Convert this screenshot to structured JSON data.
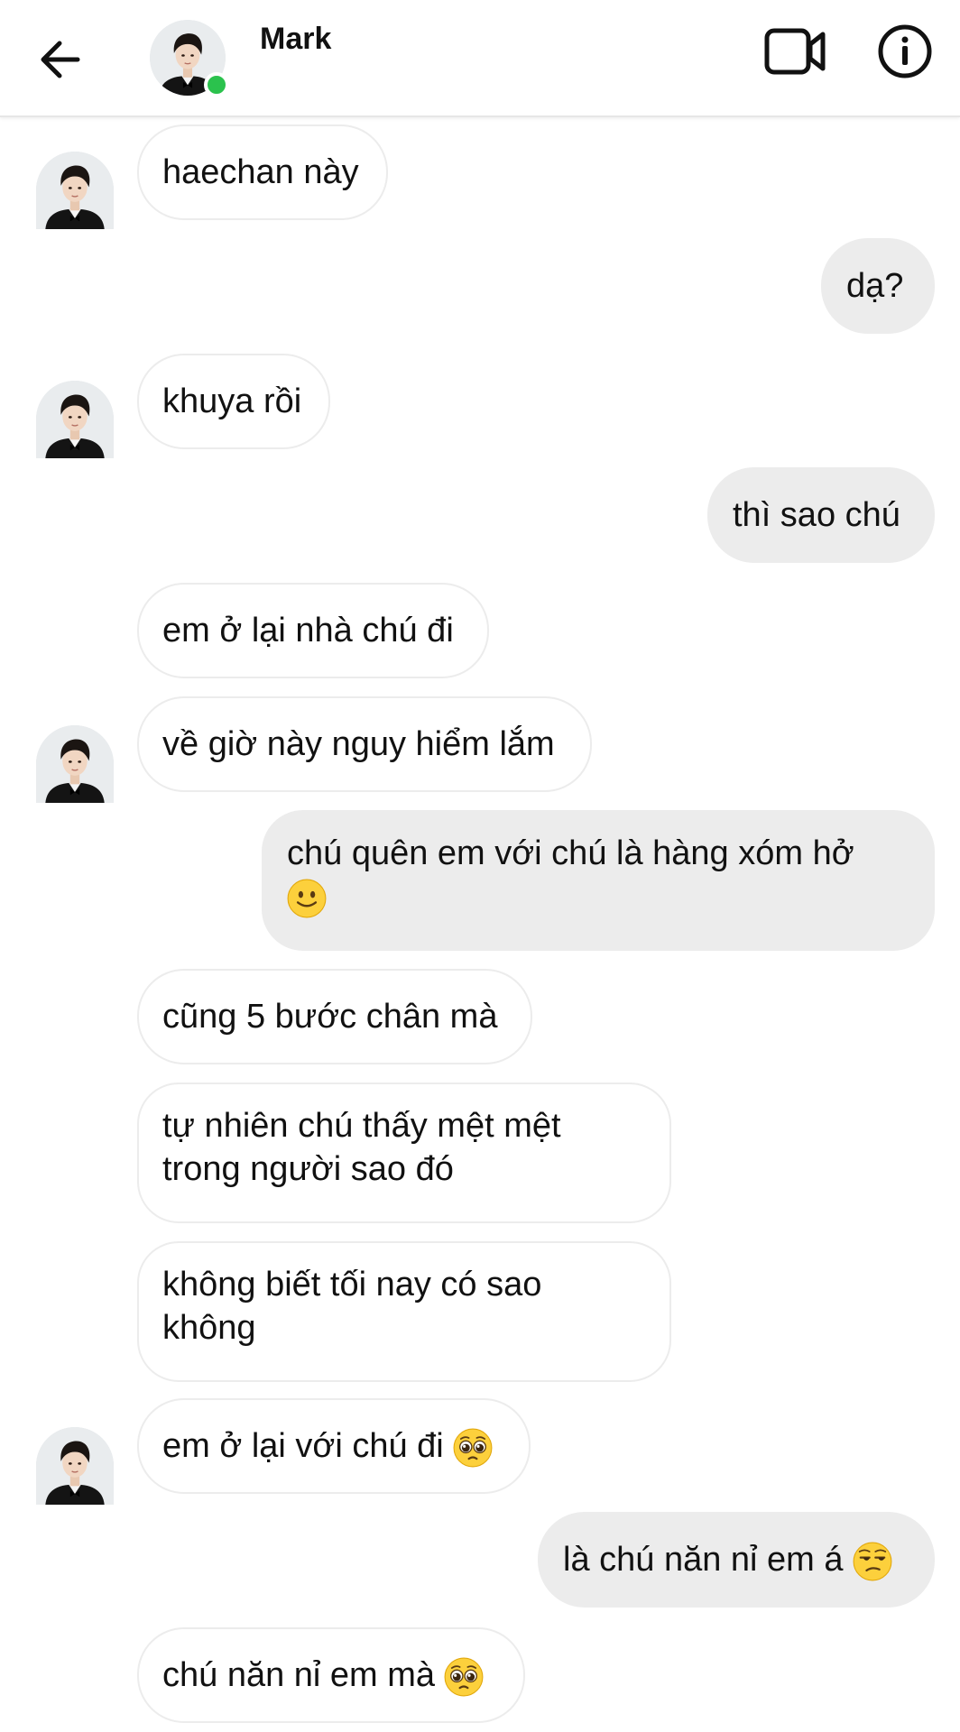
{
  "header": {
    "contact_name": "Mark",
    "online_color": "#2bc24d",
    "back_icon": "arrow-left-icon",
    "video_icon": "video-camera-icon",
    "info_icon": "info-circle-icon"
  },
  "messages": [
    {
      "from": "them",
      "text": "haechan này"
    },
    {
      "from": "me",
      "text": "dạ?"
    },
    {
      "from": "them",
      "text": "khuya rồi"
    },
    {
      "from": "me",
      "text": "thì sao chú"
    },
    {
      "from": "them",
      "text": "em ở lại nhà chú đi"
    },
    {
      "from": "them",
      "text": "về giờ này nguy hiểm lắm"
    },
    {
      "from": "me",
      "text": "chú quên em với chú là hàng xóm hở",
      "emoji": "slightly-smiling-face"
    },
    {
      "from": "them",
      "text": "cũng 5 bước chân mà"
    },
    {
      "from": "them",
      "text": "tự nhiên chú thấy mệt mệt\ntrong người sao đó"
    },
    {
      "from": "them",
      "text": "không biết tối nay có sao\nkhông"
    },
    {
      "from": "them",
      "text": "em ở lại với chú đi",
      "emoji": "pleading-face"
    },
    {
      "from": "me",
      "text": "là chú năn nỉ em á",
      "emoji": "unamused-face"
    },
    {
      "from": "them",
      "text": "chú năn nỉ em mà",
      "emoji": "pleading-face"
    }
  ]
}
